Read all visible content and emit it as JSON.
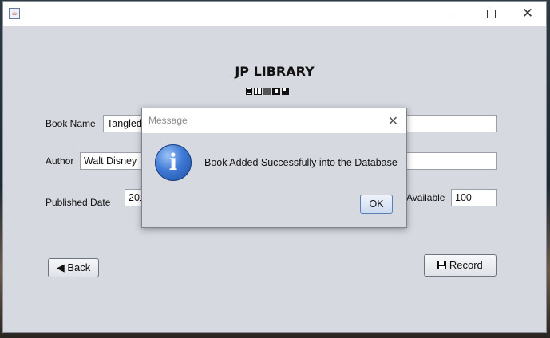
{
  "window": {
    "app_icon": "java-icon",
    "controls": {
      "minimize": "minimize-icon",
      "maximize": "maximize-icon",
      "close_glyph": "✕"
    }
  },
  "header": {
    "title": "JP LIBRARY",
    "subtitle_glyphs": "▪▪▪▪▪"
  },
  "form": {
    "book_name_label": "Book Name",
    "book_name_value": "Tangled",
    "author_label": "Author",
    "author_value": "Walt Disney",
    "published_date_label": "Published Date",
    "published_date_value": "201",
    "available_label": "Available",
    "available_value": "100"
  },
  "buttons": {
    "back_label": "◀ Back",
    "record_label": "Record"
  },
  "dialog": {
    "title": "Message",
    "close_glyph": "✕",
    "icon": "info-icon",
    "icon_glyph": "i",
    "message": "Book Added Successfully into the Database",
    "ok_label": "OK"
  }
}
